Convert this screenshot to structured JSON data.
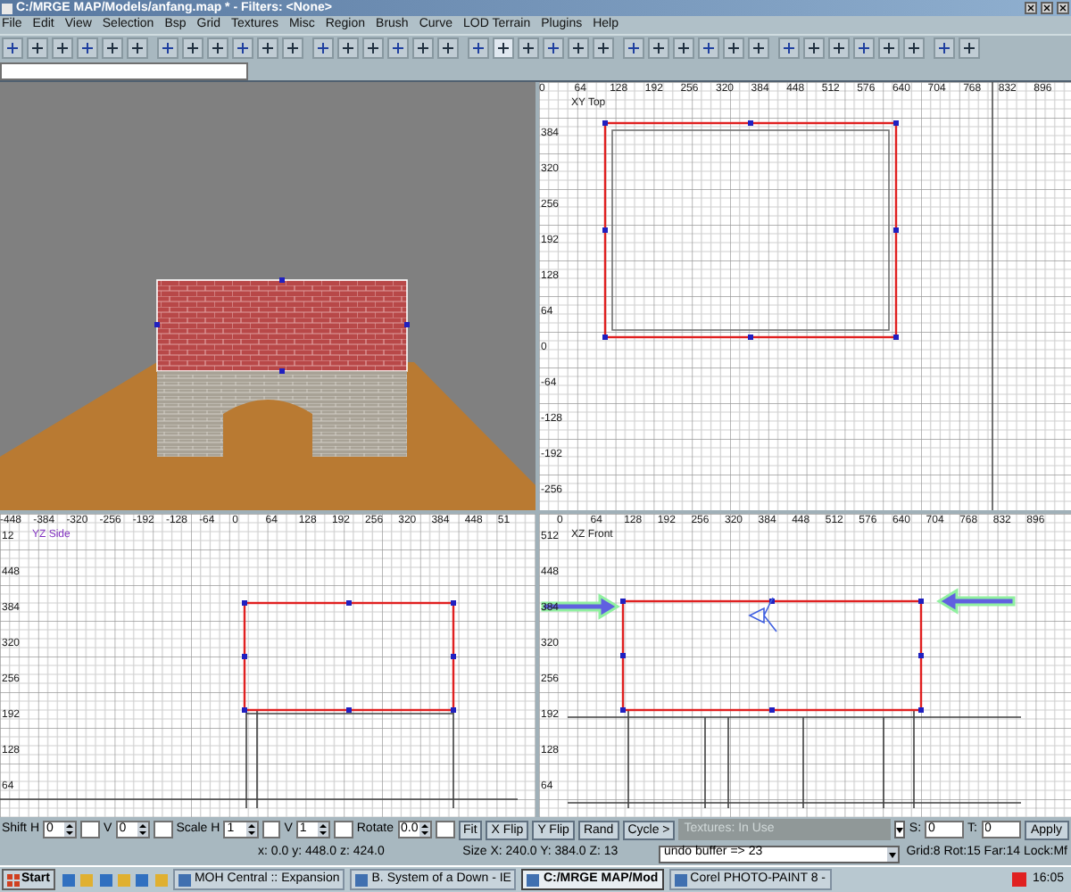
{
  "window": {
    "title": "C:/MRGE MAP/Models/anfang.map * - Filters: <None>"
  },
  "menu": [
    "File",
    "Edit",
    "View",
    "Selection",
    "Bsp",
    "Grid",
    "Textures",
    "Misc",
    "Region",
    "Brush",
    "Curve",
    "LOD Terrain",
    "Plugins",
    "Help"
  ],
  "views": [
    {
      "kind": "camera"
    },
    {
      "kind": "grid",
      "label": "XY Top",
      "x_ticks": [
        "0",
        "64",
        "128",
        "192",
        "256",
        "320",
        "384",
        "448",
        "512",
        "576",
        "640",
        "704",
        "768",
        "832",
        "896"
      ],
      "y_ticks": [
        "384",
        "320",
        "256",
        "192",
        "128",
        "64",
        "0",
        "-64",
        "-128",
        "-192",
        "-256"
      ]
    },
    {
      "kind": "grid",
      "label": "YZ Side",
      "x_ticks": [
        "-448",
        "-384",
        "-320",
        "-256",
        "-192",
        "-128",
        "-64",
        "0",
        "64",
        "128",
        "192",
        "256",
        "320",
        "384",
        "448",
        "51"
      ],
      "y_ticks": [
        "12",
        "448",
        "384",
        "320",
        "256",
        "192",
        "128",
        "64"
      ]
    },
    {
      "kind": "grid",
      "label": "XZ Front",
      "x_ticks": [
        "0",
        "64",
        "128",
        "192",
        "256",
        "320",
        "384",
        "448",
        "512",
        "576",
        "640",
        "704",
        "768",
        "832",
        "896"
      ],
      "y_ticks": [
        "512",
        "448",
        "384",
        "320",
        "256",
        "192",
        "128",
        "64"
      ]
    }
  ],
  "surface": {
    "fields": [
      {
        "label": "Shift H",
        "value": "0"
      },
      {
        "label": "V",
        "value": "0"
      },
      {
        "label": "Scale H",
        "value": "1"
      },
      {
        "label": "V",
        "value": "1"
      },
      {
        "label": "Rotate",
        "value": "0.0"
      }
    ],
    "buttons": [
      "Fit",
      "X Flip",
      "Y Flip",
      "Rand",
      "Cycle >"
    ],
    "texture_panel": "Textures: In Use",
    "s_label": "S:",
    "s_value": "0",
    "t_label": "T:",
    "t_value": "0",
    "apply": "Apply"
  },
  "status": {
    "coords": "x: 0.0  y: 448.0  z: 424.0",
    "size": "Size X: 240.0  Y: 384.0  Z: 13",
    "undo": "undo buffer => 23",
    "grid": "Grid:8 Rot:15 Far:14 Lock:Mf"
  },
  "taskbar": {
    "start": "Start",
    "tasks": [
      {
        "label": "MOH Central :: Expansion",
        "selected": false
      },
      {
        "label": "B. System of a Down - IE",
        "selected": false
      },
      {
        "label": "C:/MRGE MAP/Mod",
        "selected": true
      },
      {
        "label": "Corel PHOTO-PAINT 8 -",
        "selected": false
      }
    ],
    "clock": "16:05"
  }
}
